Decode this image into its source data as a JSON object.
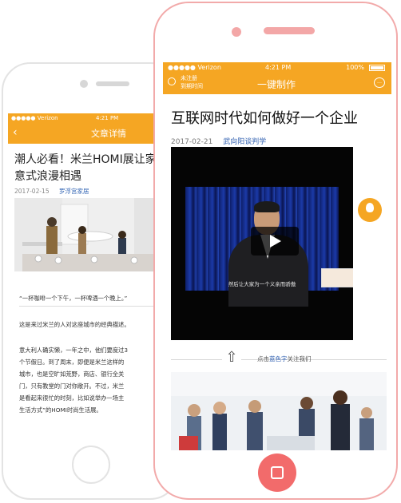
{
  "back_phone": {
    "status": {
      "carrier": "●●●●● Verizon",
      "time": "4:21 PM"
    },
    "nav": {
      "back": "‹",
      "title": "文章详情"
    },
    "article": {
      "title_line1": "潮人必看！米兰HOMI展让家与",
      "title_line2": "意式浪漫相遇",
      "date": "2017-02-15",
      "source": "罗浮宫家居",
      "quote": "“一杯咖啡一个下午，一杯啤酒一个晚上。”",
      "body_line1": "这是来过米兰的人对这座城市的经典描述。",
      "body": [
        "意大利人确实懒，一年之中，他们要度过3",
        "个节假日。到了周末，即便是米兰这样的",
        "城市，也是空旷如荒野，商店、银行全关",
        "门，只有教堂的门对你敞开。不过，米兰",
        "是看起来很忙的时刻，比如说举办一场主",
        "生活方式”的HOMI时尚生活展。"
      ]
    }
  },
  "front_phone": {
    "status": {
      "carrier": "●●●●● Verizon",
      "time": "4:21 PM",
      "battery": "100%"
    },
    "nav": {
      "left_label_1": "未注册",
      "left_label_2": "到期时间",
      "title": "一键制作",
      "chat_icon": "…"
    },
    "article": {
      "title": "互联网时代如何做好一个企业",
      "date": "2017-02-21",
      "source": "武向阳谈判学",
      "video_subtitle": "然后让大家为一个义亲而骄傲",
      "hint_prefix": "点击",
      "hint_highlight": "蓝色字",
      "hint_suffix": "关注我们",
      "up_arrow": "⇧"
    }
  }
}
